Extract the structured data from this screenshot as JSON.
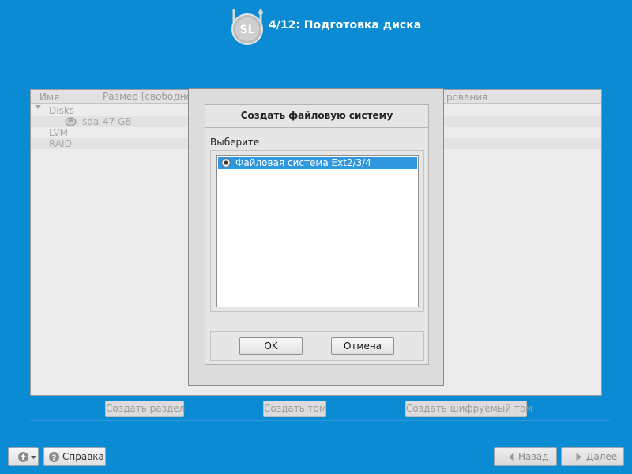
{
  "header": {
    "title": "4/12: Подготовка диска",
    "logo_text": "SL"
  },
  "partition_table": {
    "columns": [
      "Имя",
      "Размер [свободно]",
      "рования"
    ],
    "rows": [
      {
        "name": "Disks",
        "size": ""
      },
      {
        "name": "sda",
        "size": "47 GB"
      },
      {
        "name": "LVM",
        "size": ""
      },
      {
        "name": "RAID",
        "size": ""
      }
    ]
  },
  "actions": {
    "create_partition": "Создать раздел",
    "create_volume": "Создать том",
    "create_encrypted_volume": "Создать шифруемый том"
  },
  "dialog": {
    "title": "Создать файловую систему",
    "choose_label": "Выберите",
    "options": [
      "Файловая система Ext2/3/4"
    ],
    "selected_index": 0,
    "ok_label": "OK",
    "cancel_label": "Отмена"
  },
  "footer": {
    "help_label": "Справка",
    "back_label": "Назад",
    "next_label": "Далее"
  },
  "colors": {
    "background": "#0a8bd3",
    "selection": "#2e97dd"
  }
}
